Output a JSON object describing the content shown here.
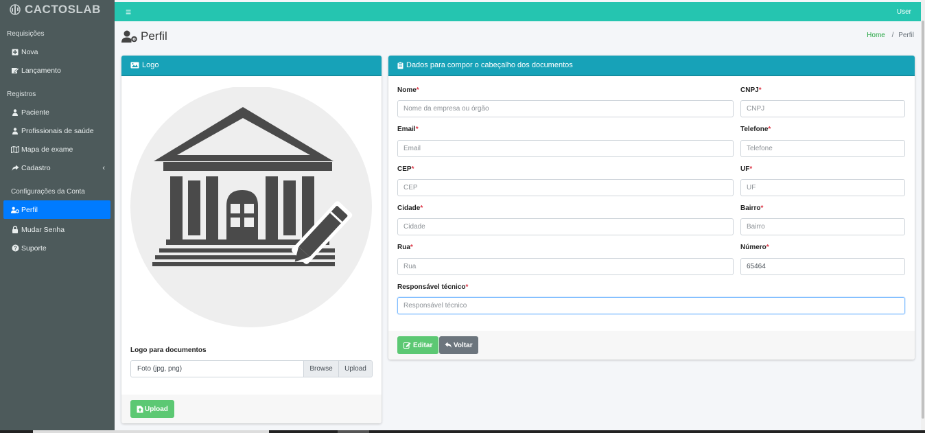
{
  "brand": {
    "name": "CACTOSLAB"
  },
  "topbar": {
    "menu_icon": "bars-icon",
    "user_label": "User"
  },
  "sidebar": {
    "sections": [
      {
        "header": "Requisições",
        "items": [
          {
            "label": "Nova",
            "icon": "plus-square-icon"
          },
          {
            "label": "Lançamento",
            "icon": "edit-icon"
          }
        ]
      },
      {
        "header": "Registros",
        "items": [
          {
            "label": "Paciente",
            "icon": "user-injured-icon"
          },
          {
            "label": "Profissionais de saúde",
            "icon": "user-md-icon"
          },
          {
            "label": "Mapa de exame",
            "icon": "map-icon"
          },
          {
            "label": "Cadastro",
            "icon": "share-icon",
            "expandable": true
          }
        ]
      },
      {
        "header": "Configurações da Conta",
        "items": [
          {
            "label": "Perfil",
            "icon": "user-cog-icon",
            "active": true
          },
          {
            "label": "Mudar Senha",
            "icon": "lock-icon"
          },
          {
            "label": "Suporte",
            "icon": "question-circle-icon"
          }
        ]
      }
    ]
  },
  "page": {
    "title": "Perfil",
    "breadcrumb": {
      "home": "Home",
      "separator": "/",
      "current": "Perfil"
    }
  },
  "logo_card": {
    "header": "Logo",
    "logo_label": "Logo para documentos",
    "file_placeholder": "Foto (jpg, png)",
    "browse_label": "Browse",
    "upload_inline_label": "Upload",
    "upload_button_label": "Upload"
  },
  "form_card": {
    "header": "Dados para compor o cabeçalho dos documentos",
    "fields": {
      "nome": {
        "label": "Nome",
        "placeholder": "Nome da empresa ou órgão",
        "value": ""
      },
      "cnpj": {
        "label": "CNPJ",
        "placeholder": "CNPJ",
        "value": ""
      },
      "email": {
        "label": "Email",
        "placeholder": "Email",
        "value": ""
      },
      "telefone": {
        "label": "Telefone",
        "placeholder": "Telefone",
        "value": ""
      },
      "cep": {
        "label": "CEP",
        "placeholder": "CEP",
        "value": ""
      },
      "uf": {
        "label": "UF",
        "placeholder": "UF",
        "value": ""
      },
      "cidade": {
        "label": "Cidade",
        "placeholder": "Cidade",
        "value": ""
      },
      "bairro": {
        "label": "Bairro",
        "placeholder": "Bairro",
        "value": ""
      },
      "rua": {
        "label": "Rua",
        "placeholder": "Rua",
        "value": ""
      },
      "numero": {
        "label": "Número",
        "placeholder": "",
        "value": "65464"
      },
      "responsavel": {
        "label": "Responsável técnico",
        "placeholder": "Responsável técnico",
        "value": ""
      }
    },
    "required_mark": "*",
    "edit_label": "Editar",
    "back_label": "Voltar"
  },
  "colors": {
    "accent": "#25c5b0",
    "card_header": "#17a2b8",
    "sidebar": "#4d5a5b",
    "active": "#007bff",
    "success": "#5cc873",
    "secondary": "#6c757d"
  }
}
